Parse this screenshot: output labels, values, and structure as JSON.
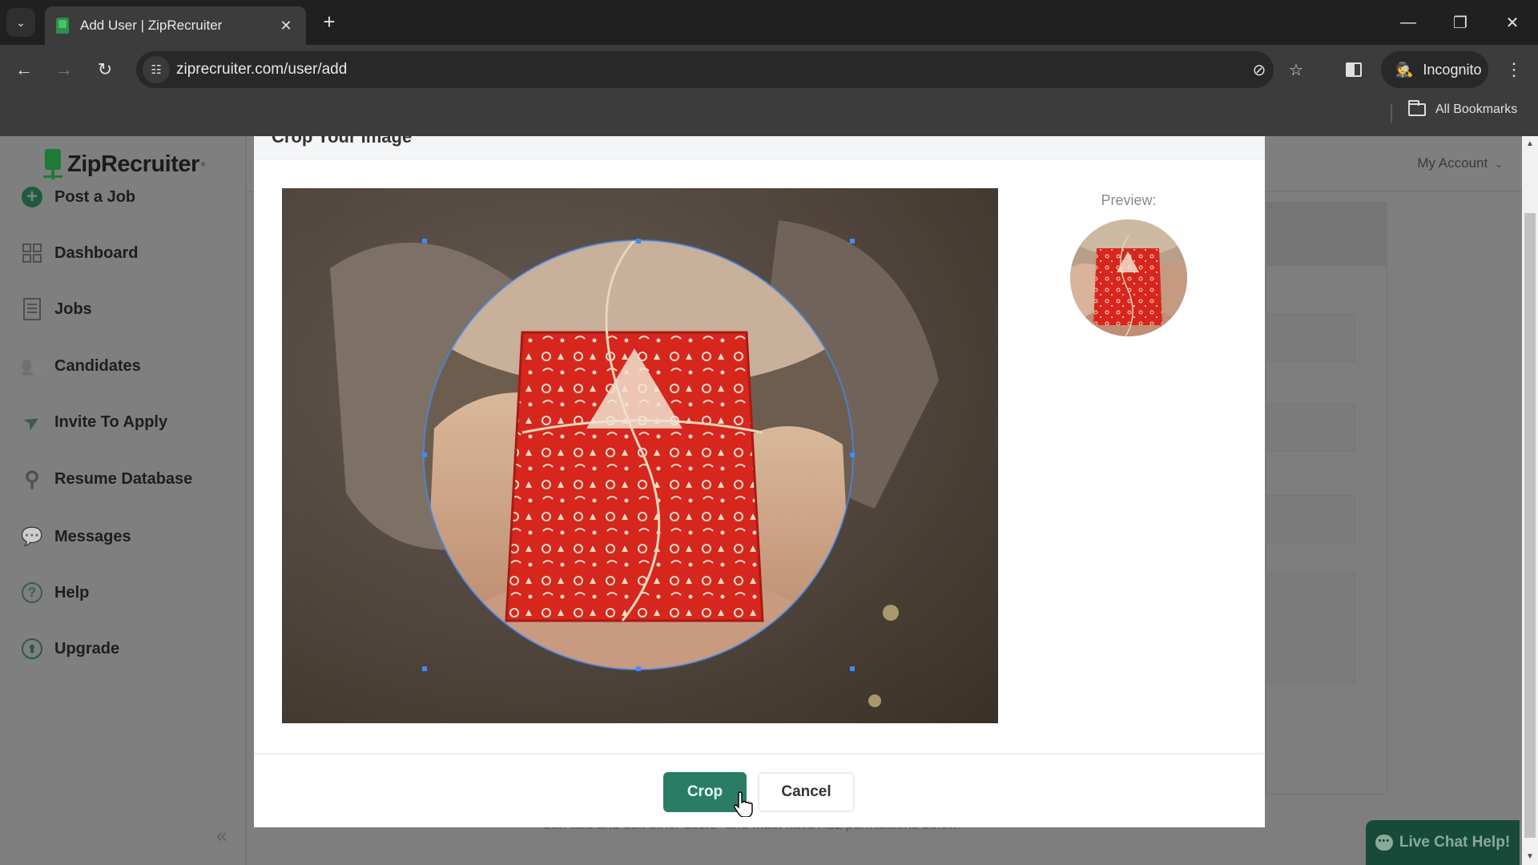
{
  "browser": {
    "tab_title": "Add User | ZipRecruiter",
    "url": "ziprecruiter.com/user/add",
    "incognito_label": "Incognito",
    "all_bookmarks_label": "All Bookmarks",
    "icons": {
      "tab_search": "chevron-down-icon",
      "tab_close": "close-icon",
      "new_tab": "plus-icon",
      "back": "arrow-left-icon",
      "forward": "arrow-right-icon",
      "reload": "reload-icon",
      "site_info": "tune-icon",
      "eye_off": "eye-off-icon",
      "bookmark": "star-icon",
      "side_panel": "side-panel-icon",
      "incognito": "incognito-icon",
      "menu": "kebab-menu-icon",
      "folder": "folder-icon"
    },
    "glyphs": {
      "tab_search": "⌄",
      "tab_close": "✕",
      "new_tab": "+",
      "back": "←",
      "forward": "→",
      "reload": "↻",
      "site_info": "☷",
      "eye_off": "⊘",
      "bookmark": "☆",
      "incognito": "🕵",
      "menu": "⋮",
      "minimize": "—",
      "restore": "❐",
      "close": "✕"
    }
  },
  "sidebar": {
    "brand": "ZipRecruiter",
    "brand_tm": "®",
    "collapse_glyph": "«",
    "items": [
      {
        "label": "Post a Job",
        "icon": "plus-circle-icon"
      },
      {
        "label": "Dashboard",
        "icon": "dashboard-grid-icon"
      },
      {
        "label": "Jobs",
        "icon": "document-list-icon"
      },
      {
        "label": "Candidates",
        "icon": "people-icon",
        "glyph": "👥"
      },
      {
        "label": "Invite To Apply",
        "icon": "send-icon",
        "glyph": "➤"
      },
      {
        "label": "Resume Database",
        "icon": "search-icon",
        "glyph": "⚲"
      },
      {
        "label": "Messages",
        "icon": "chat-icon",
        "glyph": "💬"
      },
      {
        "label": "Help",
        "icon": "help-circle-icon",
        "glyph": "?"
      },
      {
        "label": "Upgrade",
        "icon": "upgrade-icon",
        "glyph": "⬆"
      }
    ]
  },
  "header": {
    "my_account": "My Account",
    "my_account_caret": "⌄"
  },
  "background": {
    "permissions_note": "Can add and edit other users\" and must have ALL permissions below."
  },
  "modal": {
    "title": "Crop Your Image",
    "preview_label": "Preview:",
    "crop_button": "Crop",
    "cancel_button": "Cancel",
    "image_description": "Hands holding a red Christmas gift box tied with twine",
    "crop_shape": "circle"
  },
  "live_chat": {
    "label": "Live Chat Help!",
    "bubble_glyph": "•••"
  },
  "scrollbar": {
    "up_glyph": "▲",
    "down_glyph": "▼"
  },
  "colors": {
    "brand_green": "#2a7d64",
    "live_chat_bg": "#174a38",
    "overlay_gray": "#7e7e7e",
    "crop_handle": "#3d8bfd"
  }
}
